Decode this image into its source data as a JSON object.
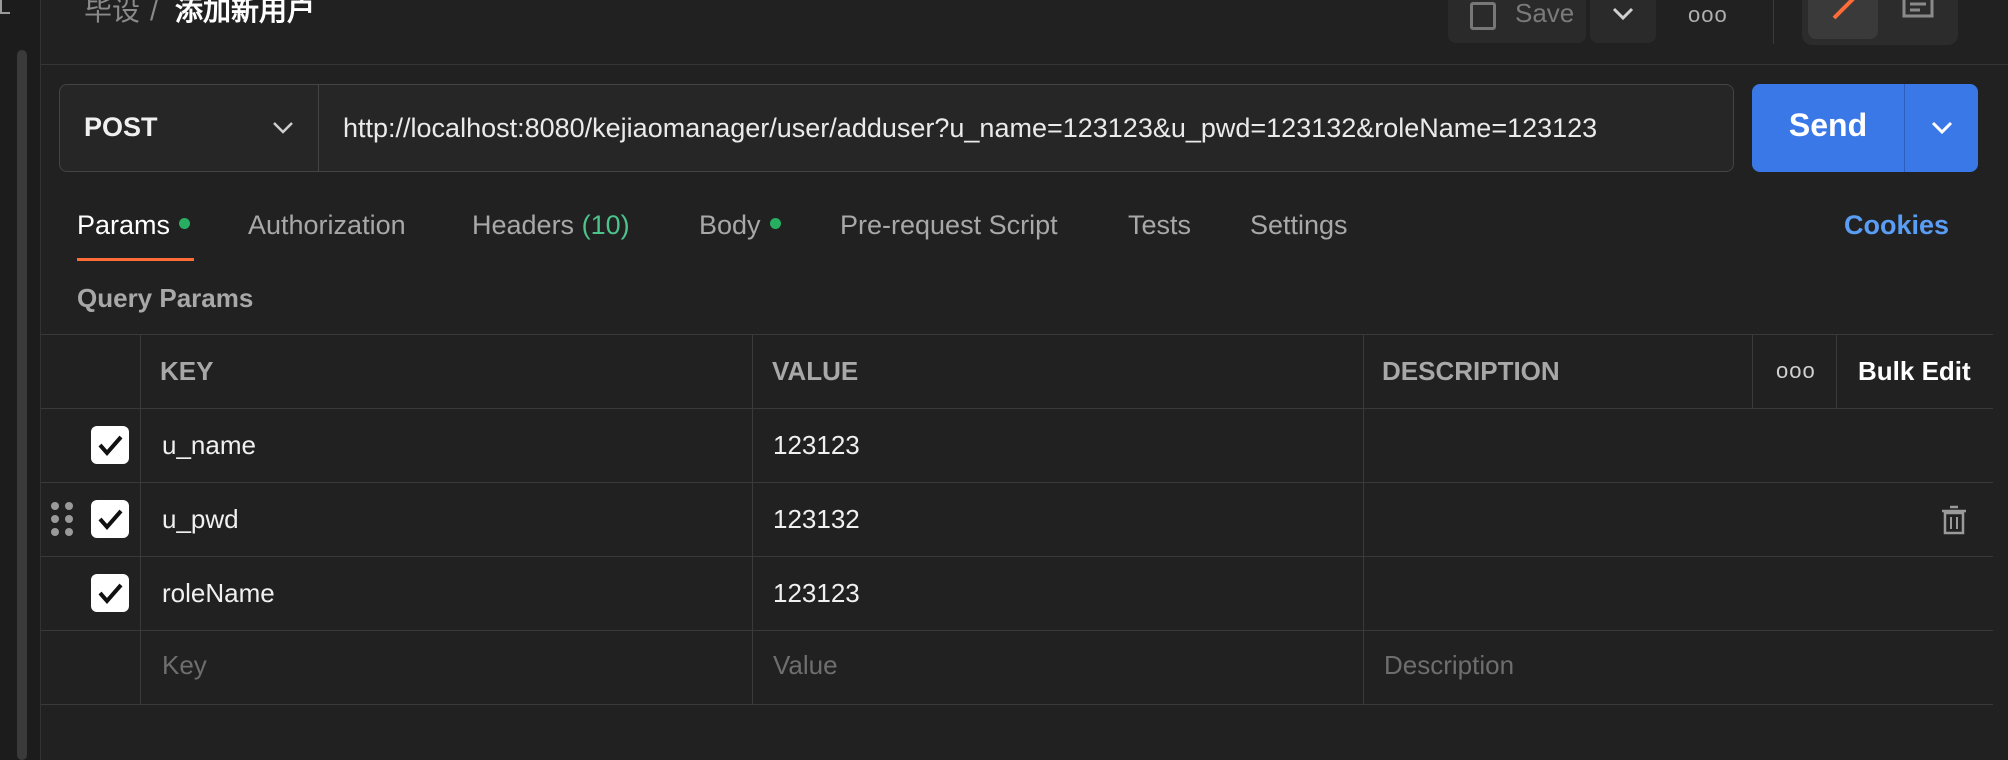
{
  "breadcrumb": {
    "parent": "毕设",
    "separator": "/",
    "current": "添加新用户"
  },
  "toolbar": {
    "save_label": "Save",
    "more_label": "ooo"
  },
  "request": {
    "method": "POST",
    "url": "http://localhost:8080/kejiaomanager/user/adduser?u_name=123123&u_pwd=123132&roleName=123123",
    "send_label": "Send"
  },
  "tabs": [
    {
      "label": "Params",
      "dot": true
    },
    {
      "label": "Authorization"
    },
    {
      "label": "Headers",
      "count": "(10)"
    },
    {
      "label": "Body",
      "dot": true
    },
    {
      "label": "Pre-request Script"
    },
    {
      "label": "Tests"
    },
    {
      "label": "Settings"
    }
  ],
  "cookies_label": "Cookies",
  "query_params": {
    "title": "Query Params",
    "headers": {
      "key": "KEY",
      "value": "VALUE",
      "description": "DESCRIPTION",
      "more": "ooo",
      "bulk_edit": "Bulk Edit"
    },
    "rows": [
      {
        "key": "u_name",
        "value": "123123",
        "description": "",
        "checked": true
      },
      {
        "key": "u_pwd",
        "value": "123132",
        "description": "",
        "checked": true
      },
      {
        "key": "roleName",
        "value": "123123",
        "description": "",
        "checked": true
      }
    ],
    "placeholders": {
      "key": "Key",
      "value": "Value",
      "description": "Description"
    }
  },
  "colors": {
    "accent_send": "#3b78e7",
    "tab_underline": "#ff6c37",
    "dot_green": "#27ae60",
    "cookies": "#5a9df5"
  }
}
